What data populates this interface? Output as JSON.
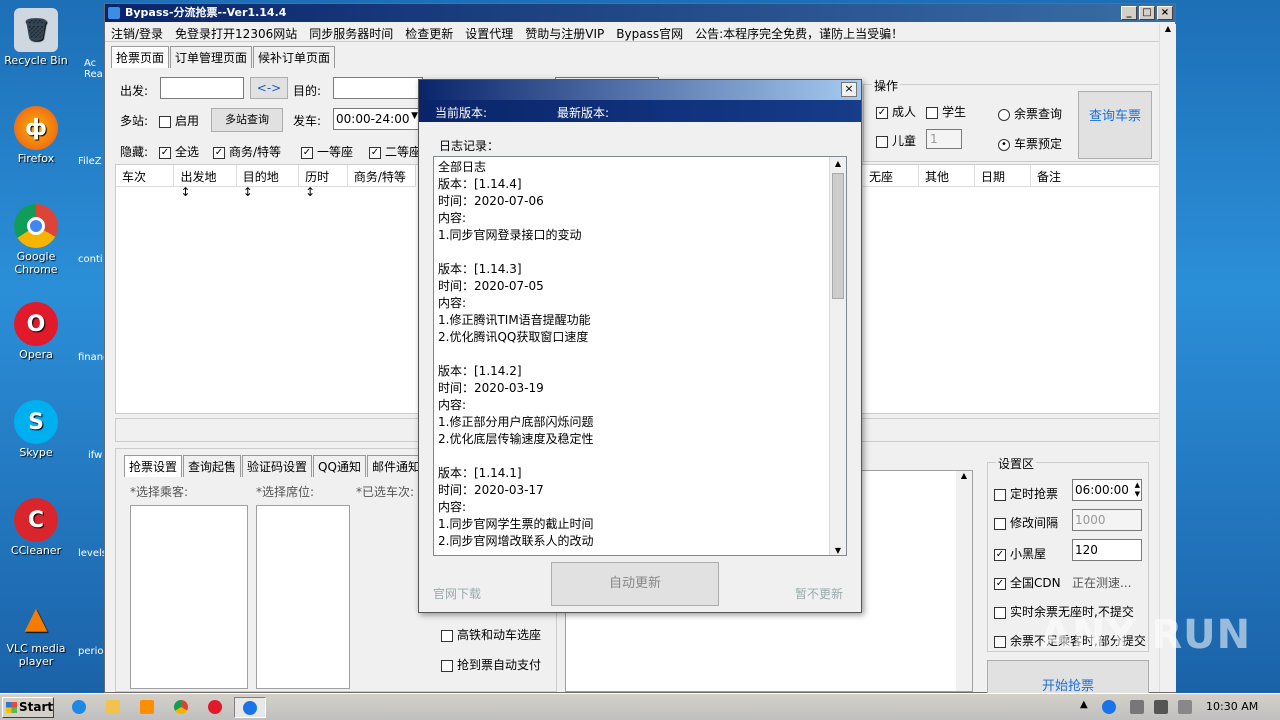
{
  "desktop": {
    "icons": [
      {
        "label": "Recycle Bin"
      },
      {
        "label": "Firefox"
      },
      {
        "label": "Google Chrome"
      },
      {
        "label": "Opera"
      },
      {
        "label": "Skype"
      },
      {
        "label": "CCleaner"
      },
      {
        "label": "VLC media player"
      }
    ],
    "partial_icons": [
      "Ac Rea",
      "FileZ",
      "conti",
      "financ",
      "ifw",
      "levels",
      "period"
    ]
  },
  "window": {
    "title": "Bypass-分流抢票--Ver1.14.4",
    "menu": [
      "注销/登录",
      "免登录打开12306网站",
      "同步服务器时间",
      "检查更新",
      "设置代理",
      "赞助与注册VIP",
      "Bypass官网",
      "公告:本程序完全免费，谨防上当受骗！"
    ],
    "tabs": [
      "抢票页面",
      "订单管理页面",
      "候补订单页面"
    ],
    "form": {
      "from_label": "出发:",
      "swap_label": "<->",
      "to_label": "目的:",
      "multi_label": "多站:",
      "enable_label": "启用",
      "multi_query_label": "多站查询",
      "depart_label": "发车:",
      "depart_time": "00:00-24:00",
      "hide_label": "隐藏:",
      "hide_all": "全选",
      "hide_business": "商务/特等",
      "hide_first": "一等座",
      "hide_second": "二等座"
    },
    "ops": {
      "title": "操作",
      "adult": "成人",
      "student": "学生",
      "child": "儿童",
      "child_count": "1",
      "remaining_query": "余票查询",
      "ticket_booking": "车票预定",
      "query_button": "查询车票"
    },
    "grid_headers": [
      "车次",
      "出发地 ↕",
      "目的地 ↕",
      "历时 ↕",
      "商务/特等",
      "无座",
      "其他",
      "日期",
      "备注"
    ],
    "bottom_tabs": [
      "抢票设置",
      "查询起售",
      "验证码设置",
      "QQ通知",
      "邮件通知"
    ],
    "bottom_labels": {
      "passengers": "*选择乘客:",
      "seats": "*选择席位:",
      "selected_trains": "*已选车次:"
    },
    "bottom_checks": [
      "高铁和动车选座",
      "抢到票自动支付"
    ],
    "settings": {
      "title": "设置区",
      "timed": "定时抢票",
      "timed_value": "06:00:00",
      "interval": "修改间隔",
      "interval_value": "1000",
      "blacklist": "小黑屋",
      "blacklist_value": "120",
      "cdn": "全国CDN",
      "cdn_status": "正在测速...",
      "realtime": "实时余票无座时,不提交",
      "partial": "余票不足乘客时,部分提交",
      "start_button": "开始抢票"
    }
  },
  "dialog": {
    "current_version_label": "当前版本:",
    "latest_version_label": "最新版本:",
    "log_label": "日志记录：",
    "log_lines": [
      "全部日志",
      "版本：[1.14.4]",
      "时间：2020-07-06",
      "内容:",
      "1.同步官网登录接口的变动",
      "",
      "版本：[1.14.3]",
      "时间：2020-07-05",
      "内容:",
      "1.修正腾讯TIM语音提醒功能",
      "2.优化腾讯QQ获取窗口速度",
      "",
      "版本：[1.14.2]",
      "时间：2020-03-19",
      "内容:",
      "1.修正部分用户底部闪烁问题",
      "2.优化底层传输速度及稳定性",
      "",
      "版本：[1.14.1]",
      "时间：2020-03-17",
      "内容:",
      "1.同步官网学生票的截止时间",
      "2.同步官网增改联系人的改动"
    ],
    "official_download": "官网下载",
    "auto_update": "自动更新",
    "skip_update": "暂不更新",
    "close": "×"
  },
  "taskbar": {
    "start": "Start",
    "time": "10:30 AM"
  },
  "watermark": "ANY RUN"
}
